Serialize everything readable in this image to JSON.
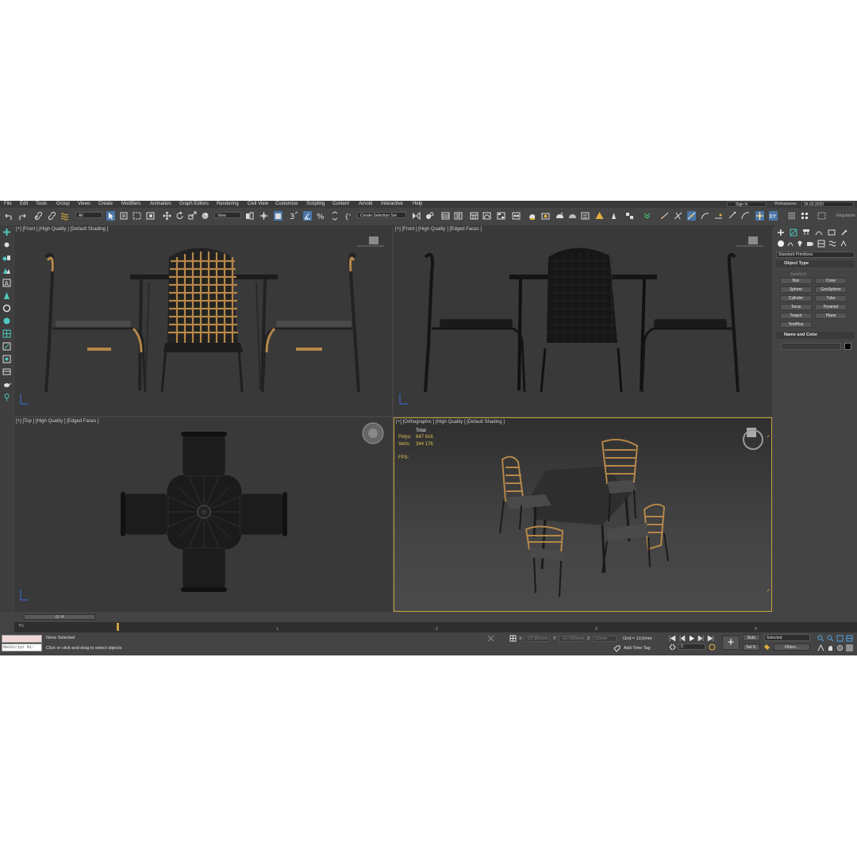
{
  "menu": [
    "File",
    "Edit",
    "Tools",
    "Group",
    "Views",
    "Create",
    "Modifiers",
    "Animation",
    "Graph Editors",
    "Rendering",
    "Civil View",
    "Customize",
    "Scripting",
    "Content",
    "Arnold",
    "Interactive",
    "Help"
  ],
  "account": {
    "signin": "Sign In",
    "workspaces_label": "Workspaces:",
    "workspace": "26.03.2020"
  },
  "toolbar": {
    "filter": "All",
    "view": "View",
    "selection_set": "Create Selection Set",
    "regularize": "Regularize"
  },
  "viewports": {
    "front1": "[+] [Front ] [High Quality ] [Default Shading ]",
    "front2": "[+] [Front ] [High Quality ] [Edged Faces ]",
    "top": "[+] [Top ] [High Quality ] [Edged Faces ]",
    "ortho": "[+] [Orthographic ] [High Quality ] [Default Shading ]"
  },
  "stats": {
    "total_label": "Total",
    "polys_label": "Polys:",
    "polys": "647 616",
    "verts_label": "Verts:",
    "verts": "344 176",
    "fps_label": "FPS:"
  },
  "command_panel": {
    "category": "Standard Primitives",
    "object_type_title": "Object Type",
    "autogrid": "AutoGrid",
    "buttons": [
      "Box",
      "Cone",
      "Sphere",
      "GeoSphere",
      "Cylinder",
      "Tube",
      "Torus",
      "Pyramid",
      "Teapot",
      "Plane",
      "TextPlus"
    ],
    "name_color_title": "Name and Color"
  },
  "timeline": {
    "slider": "0 / 4",
    "ticks": [
      "0",
      "1",
      "2",
      "3",
      "4"
    ],
    "fps_btn": "f%"
  },
  "status": {
    "maxscript": "MAXScript Mi:",
    "selection": "None Selected",
    "prompt": "Click or click-and-drag to select objects",
    "x_label": "X:",
    "x": "137,861mm",
    "y_label": "Y:",
    "y": "-317,043mm",
    "z_label": "Z:",
    "z": "0,0mm",
    "grid": "Grid = 10,0mm",
    "add_time_tag": "Add Time Tag",
    "auto": "Auto",
    "selected": "Selected",
    "set_key": "Set K.",
    "filters": "Filters...",
    "frame": "0"
  },
  "colors": {
    "active_blue": "#4b76a8",
    "viewport_bg": "#393939",
    "stats_yellow": "#e0c050",
    "wicker": "#b5874a"
  },
  "icons": [
    "undo-icon",
    "redo-icon",
    "link-icon",
    "unlink-icon",
    "bind-space-warp-icon",
    "select-object-icon",
    "select-by-name-icon",
    "rect-region-icon",
    "window-crossing-icon",
    "move-icon",
    "rotate-icon",
    "scale-icon",
    "snap-icon",
    "angle-snap-icon",
    "percent-snap-icon",
    "spinner-snap-icon",
    "mirror-icon",
    "align-icon",
    "layer-icon",
    "schematic-icon",
    "material-editor-icon",
    "render-setup-icon",
    "render-icon"
  ]
}
